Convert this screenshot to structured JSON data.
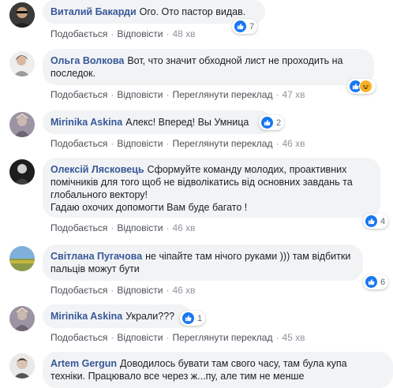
{
  "actions": {
    "like": "Подобається",
    "reply": "Відповісти",
    "translate": "Переглянути переклад",
    "dot": "·"
  },
  "colors": {
    "name": "#385898",
    "bubble": "#f2f3f5",
    "like": "#1877f2",
    "haha": "#f7b125"
  },
  "comments": [
    {
      "author": "Виталий Бакарди",
      "text": "Ого. Ото пастор видав.",
      "time": "48 хв",
      "reactions": "7",
      "reaction_icons": [
        "like-icon"
      ],
      "translate": false
    },
    {
      "author": "Ольга Волкова",
      "text": "Вот, что значит обходной лист не проходить на последок.",
      "time": "47 хв",
      "reactions": "",
      "reaction_icons": [
        "like-icon",
        "haha-icon"
      ],
      "translate": true
    },
    {
      "author": "Mirinika Askina",
      "text": "Алекс! Вперед! Вы Умница",
      "time": "46 хв",
      "reactions": "2",
      "reaction_icons": [
        "like-icon"
      ],
      "translate": true
    },
    {
      "author": "Олексій Лясковець",
      "text": "Сформуйте команду молодих, проактивних помічників для того щоб не відволікатись від основних завдань та глобального вектору!",
      "text2": "Гадаю охочих допомогти Вам буде багато !",
      "time": "46 хв",
      "reactions": "4",
      "reaction_icons": [
        "like-icon"
      ],
      "translate": false
    },
    {
      "author": "Світлана Пугачова",
      "text": "не чіпайте там нічого руками ))) там відбитки пальців можут бути",
      "time": "46 хв",
      "reactions": "6",
      "reaction_icons": [
        "like-icon"
      ],
      "translate": false
    },
    {
      "author": "Mirinika Askina",
      "text": "Украли???",
      "time": "45 хв",
      "reactions": "1",
      "reaction_icons": [
        "like-icon"
      ],
      "translate": true
    },
    {
      "author": "Artem Gergun",
      "text": "Доводилось бувати там свого часу, там була купа техніки. Працювало все через ж...пу, але тим не менше",
      "time": "",
      "reactions": "",
      "reaction_icons": [],
      "translate": false
    }
  ]
}
